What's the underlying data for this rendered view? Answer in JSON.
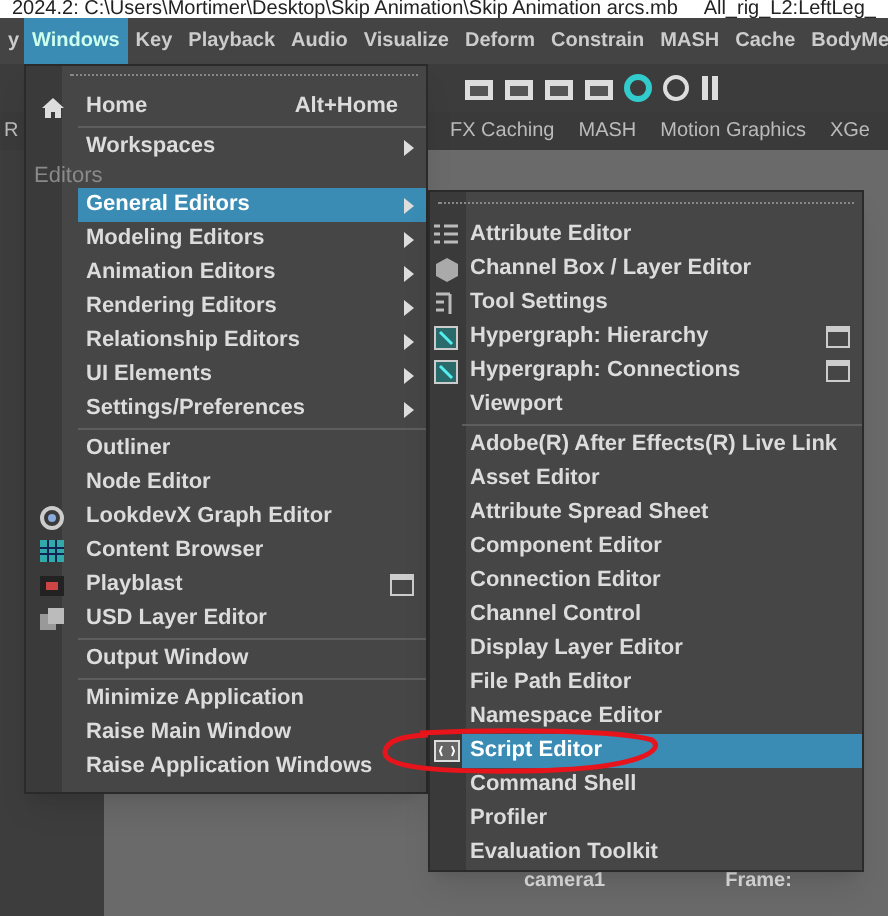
{
  "title_bar": {
    "path": "2024.2: C:\\Users\\Mortimer\\Desktop\\Skip Animation\\Skip Animation arcs.mb",
    "node": "All_rig_L2:LeftLeg_"
  },
  "menu_bar": [
    {
      "label": "y",
      "selected": false
    },
    {
      "label": "Windows",
      "selected": true
    },
    {
      "label": "Key",
      "selected": false
    },
    {
      "label": "Playback",
      "selected": false
    },
    {
      "label": "Audio",
      "selected": false
    },
    {
      "label": "Visualize",
      "selected": false
    },
    {
      "label": "Deform",
      "selected": false
    },
    {
      "label": "Constrain",
      "selected": false
    },
    {
      "label": "MASH",
      "selected": false
    },
    {
      "label": "Cache",
      "selected": false
    },
    {
      "label": "BodyMe",
      "selected": false
    }
  ],
  "shelf_tabs": [
    "R",
    "FX Caching",
    "MASH",
    "Motion Graphics",
    "XGe"
  ],
  "viewport": {
    "camera": "camera1",
    "frame": "Frame:"
  },
  "windows_menu": [
    {
      "kind": "item",
      "label": "Home",
      "shortcut": "Alt+Home",
      "submenu": false,
      "option_box": false,
      "selected": false
    },
    {
      "kind": "separator"
    },
    {
      "kind": "item",
      "label": "Workspaces",
      "submenu": true,
      "option_box": false,
      "selected": false
    },
    {
      "kind": "section",
      "label": "Editors"
    },
    {
      "kind": "item",
      "label": "General Editors",
      "submenu": true,
      "option_box": false,
      "selected": true
    },
    {
      "kind": "item",
      "label": "Modeling Editors",
      "submenu": true,
      "option_box": false,
      "selected": false
    },
    {
      "kind": "item",
      "label": "Animation Editors",
      "submenu": true,
      "option_box": false,
      "selected": false
    },
    {
      "kind": "item",
      "label": "Rendering Editors",
      "submenu": true,
      "option_box": false,
      "selected": false
    },
    {
      "kind": "item",
      "label": "Relationship Editors",
      "submenu": true,
      "option_box": false,
      "selected": false
    },
    {
      "kind": "item",
      "label": "UI Elements",
      "submenu": true,
      "option_box": false,
      "selected": false
    },
    {
      "kind": "item",
      "label": "Settings/Preferences",
      "submenu": true,
      "option_box": false,
      "selected": false
    },
    {
      "kind": "separator"
    },
    {
      "kind": "item",
      "label": "Outliner",
      "submenu": false,
      "option_box": false,
      "selected": false
    },
    {
      "kind": "item",
      "label": "Node Editor",
      "submenu": false,
      "option_box": false,
      "selected": false
    },
    {
      "kind": "item",
      "label": "LookdevX Graph Editor",
      "submenu": false,
      "option_box": false,
      "selected": false
    },
    {
      "kind": "item",
      "label": "Content Browser",
      "submenu": false,
      "option_box": false,
      "selected": false
    },
    {
      "kind": "item",
      "label": "Playblast",
      "submenu": false,
      "option_box": true,
      "selected": false
    },
    {
      "kind": "item",
      "label": "USD Layer Editor",
      "submenu": false,
      "option_box": false,
      "selected": false
    },
    {
      "kind": "separator"
    },
    {
      "kind": "item",
      "label": "Output Window",
      "submenu": false,
      "option_box": false,
      "selected": false
    },
    {
      "kind": "separator"
    },
    {
      "kind": "item",
      "label": "Minimize Application",
      "submenu": false,
      "option_box": false,
      "selected": false
    },
    {
      "kind": "item",
      "label": "Raise Main Window",
      "submenu": false,
      "option_box": false,
      "selected": false
    },
    {
      "kind": "item",
      "label": "Raise Application Windows",
      "submenu": false,
      "option_box": false,
      "selected": false
    }
  ],
  "general_editors_menu": [
    {
      "kind": "item",
      "label": "Attribute Editor",
      "option_box": false,
      "selected": false
    },
    {
      "kind": "item",
      "label": "Channel Box / Layer Editor",
      "option_box": false,
      "selected": false
    },
    {
      "kind": "item",
      "label": "Tool Settings",
      "option_box": false,
      "selected": false
    },
    {
      "kind": "item",
      "label": "Hypergraph: Hierarchy",
      "option_box": true,
      "selected": false
    },
    {
      "kind": "item",
      "label": "Hypergraph: Connections",
      "option_box": true,
      "selected": false
    },
    {
      "kind": "item",
      "label": "Viewport",
      "option_box": false,
      "selected": false
    },
    {
      "kind": "separator"
    },
    {
      "kind": "item",
      "label": "Adobe(R) After Effects(R) Live Link",
      "option_box": false,
      "selected": false
    },
    {
      "kind": "item",
      "label": "Asset Editor",
      "option_box": false,
      "selected": false
    },
    {
      "kind": "item",
      "label": "Attribute Spread Sheet",
      "option_box": false,
      "selected": false
    },
    {
      "kind": "item",
      "label": "Component Editor",
      "option_box": false,
      "selected": false
    },
    {
      "kind": "item",
      "label": "Connection Editor",
      "option_box": false,
      "selected": false
    },
    {
      "kind": "item",
      "label": "Channel Control",
      "option_box": false,
      "selected": false
    },
    {
      "kind": "item",
      "label": "Display Layer Editor",
      "option_box": false,
      "selected": false
    },
    {
      "kind": "item",
      "label": "File Path Editor",
      "option_box": false,
      "selected": false
    },
    {
      "kind": "item",
      "label": "Namespace Editor",
      "option_box": false,
      "selected": false
    },
    {
      "kind": "item",
      "label": "Script Editor",
      "option_box": false,
      "selected": true
    },
    {
      "kind": "item",
      "label": "Command Shell",
      "option_box": false,
      "selected": false
    },
    {
      "kind": "item",
      "label": "Profiler",
      "option_box": false,
      "selected": false
    },
    {
      "kind": "item",
      "label": "Evaluation Toolkit",
      "option_box": false,
      "selected": false
    }
  ]
}
